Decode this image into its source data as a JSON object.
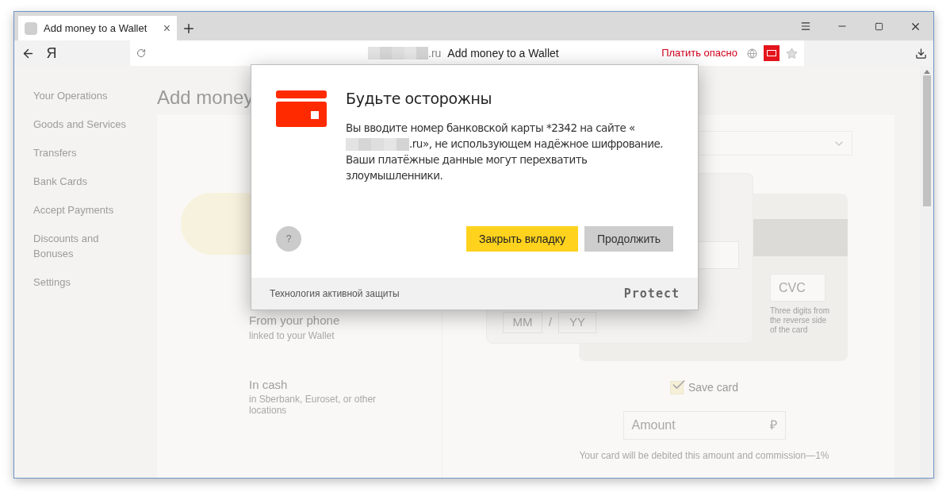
{
  "tab": {
    "title": "Add money to a Wallet",
    "close": "×"
  },
  "address_bar": {
    "domain_suffix": ".ru",
    "page_title": "Add money to a Wallet",
    "warning": "Платить опасно"
  },
  "yandex_button": "Я",
  "sidebar": {
    "items": [
      {
        "label": "Your Operations"
      },
      {
        "label": "Goods and Services"
      },
      {
        "label": "Transfers"
      },
      {
        "label": "Bank Cards"
      },
      {
        "label": "Accept Payments"
      },
      {
        "label": "Discounts and Bonuses"
      },
      {
        "label": "Settings"
      }
    ]
  },
  "page": {
    "heading": "Add money",
    "methods": [
      {
        "title": "From your phone",
        "subtitle": "linked to your Wallet"
      },
      {
        "title": "In cash",
        "subtitle": "in Sberbank, Euroset, or other locations"
      }
    ],
    "card_form": {
      "month_placeholder": "MM",
      "separator": "/",
      "year_placeholder": "YY",
      "cvc_placeholder": "CVC",
      "cvc_hint": "Three digits from the reverse side of the card"
    },
    "save_card": {
      "label": "Save card",
      "checked": true
    },
    "amount": {
      "placeholder": "Amount",
      "currency": "₽"
    },
    "commission_note": "Your card will be debited this amount and commission—1%"
  },
  "dialog": {
    "title": "Будьте осторожны",
    "message_before": "Вы вводите номер банковской карты *2342 на сайте «",
    "message_after": ".ru», не использующем надёжное шифрование. Ваши платёжные данные могут перехватить злоумышленники.",
    "help": "?",
    "buttons": [
      {
        "label": "Закрыть вкладку",
        "kind": "primary"
      },
      {
        "label": "Продолжить",
        "kind": "secondary"
      }
    ],
    "footer": "Технология активной защиты",
    "brand": "Protect"
  }
}
